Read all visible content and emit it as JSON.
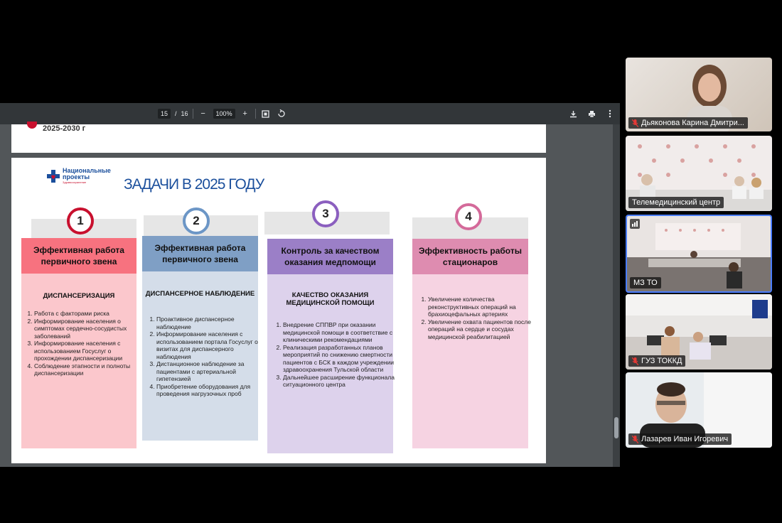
{
  "toolbar": {
    "page_current": "15",
    "page_sep": "/",
    "page_total": "16",
    "zoom_out": "−",
    "zoom": "100%",
    "zoom_in": "+",
    "download_icon": "download-icon",
    "print_icon": "print-icon",
    "more_icon": "more-vert-icon"
  },
  "prev_page": {
    "text": "2025-2030 г"
  },
  "slide": {
    "logo_line1": "Национальные",
    "logo_line2": "проекты",
    "logo_line3": "Здравоохранение",
    "title": "ЗАДАЧИ В 2025 ГОДУ",
    "columns": [
      {
        "number": "1",
        "heading": "Эффективная работа первичного звена",
        "section": "ДИСПАНСЕРИЗАЦИЯ",
        "items": [
          "Работа с факторами риска",
          "Информирование населения о симптомах сердечно-сосудистых заболеваний",
          "Информирование населения с использованием Госуслуг о прохождении диспансеризации",
          "Соблюдение этапности и полноты диспансеризации"
        ]
      },
      {
        "number": "2",
        "heading": "Эффективная работа первичного звена",
        "section": "ДИСПАНСЕРНОЕ НАБЛЮДЕНИЕ",
        "items": [
          "Проактивное диспансерное наблюдение",
          "Информирование населения с использованием портала Госуслуг о визитах для диспансерного наблюдения",
          "Дистанционное наблюдение за пациентами с артериальной гипетензией",
          "Приобретение оборудования для проведения нагрузочных проб"
        ]
      },
      {
        "number": "3",
        "heading": "Контроль за качеством оказания медпомощи",
        "section": "КАЧЕСТВО ОКАЗАНИЯ МЕДИЦИНСКОЙ ПОМОЩИ",
        "items": [
          "Внедрение СППВР при оказании медицинской помощи в соответствие с клиническими рекомендациями",
          "Реализация разработанных планов мероприятий по снижению смертности пациентов с БСК в каждом учреждении здравоохранения Тульской области",
          "Дальнейшее расширение функционала ситуационного центра"
        ]
      },
      {
        "number": "4",
        "heading": "Эффективность работы стационаров",
        "section": "",
        "items": [
          "Увеличение количества реконструктивных операций на брахиоцефальных артериях",
          "Увеличение охвата пациентов после операций на сердце и сосудах медицинской реабилитацией"
        ]
      }
    ]
  },
  "participants": [
    {
      "name": "Дьяконова Карина Дмитри...",
      "muted": true
    },
    {
      "name": "Телемедицинский центр",
      "muted": false
    },
    {
      "name": "МЗ ТО",
      "muted": false
    },
    {
      "name": "ГУЗ ТОККД",
      "muted": true
    },
    {
      "name": "Лазарев Иван Игоревич",
      "muted": true
    }
  ],
  "colors": {
    "col1_head": "#f7727f",
    "col1_body": "#fbc7cc",
    "col1_ring": "#c8102e",
    "col2_head": "#7f9fc5",
    "col2_body": "#d4dde9",
    "col2_ring": "#6c96c6",
    "col3_head": "#9b7fc7",
    "col3_body": "#ddd2ec",
    "col3_ring": "#8b5fbf",
    "col4_head": "#de8cb0",
    "col4_body": "#f6d3e2",
    "col4_ring": "#d46a9a",
    "active_speaker": "#4a7dff"
  }
}
